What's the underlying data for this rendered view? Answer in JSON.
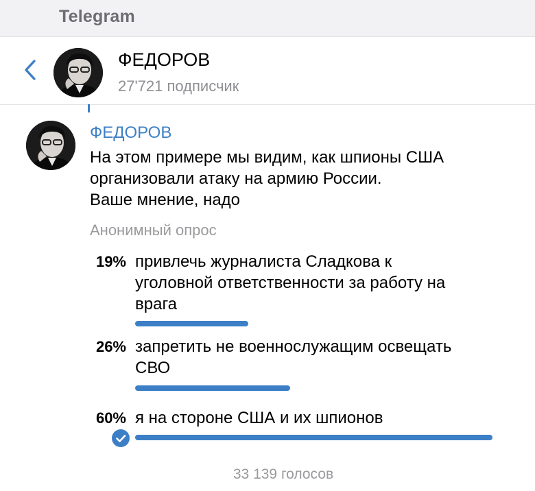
{
  "app": {
    "title": "Telegram"
  },
  "header": {
    "channel_name": "ФЕДОРОВ",
    "subscribers": "27'721 подписчик",
    "back_icon": "chevron-left-icon"
  },
  "post": {
    "author": "ФЕДОРОВ",
    "text_lines": [
      "На этом примере мы видим, как шпионы США",
      "организовали атаку на армию России.",
      "Ваше мнение, надо"
    ],
    "poll": {
      "type_label": "Анонимный опрос",
      "options": [
        {
          "percent_label": "19%",
          "percent": 19,
          "lines": [
            "привлечь журналиста Сладкова к",
            "уголовной ответственности за работу на",
            "врага"
          ],
          "chosen": false
        },
        {
          "percent_label": "26%",
          "percent": 26,
          "lines": [
            "запретить не военнослужащим освещать",
            "СВО"
          ],
          "chosen": false
        },
        {
          "percent_label": "60%",
          "percent": 60,
          "lines": [
            "я на стороне США и их шпионов"
          ],
          "chosen": true
        }
      ],
      "votes": "33 139 голосов"
    }
  },
  "colors": {
    "accent": "#3d7fc6",
    "author": "#3f80c6",
    "secondary_text": "#8e8e93",
    "top_bar": "#f2f2f4"
  }
}
